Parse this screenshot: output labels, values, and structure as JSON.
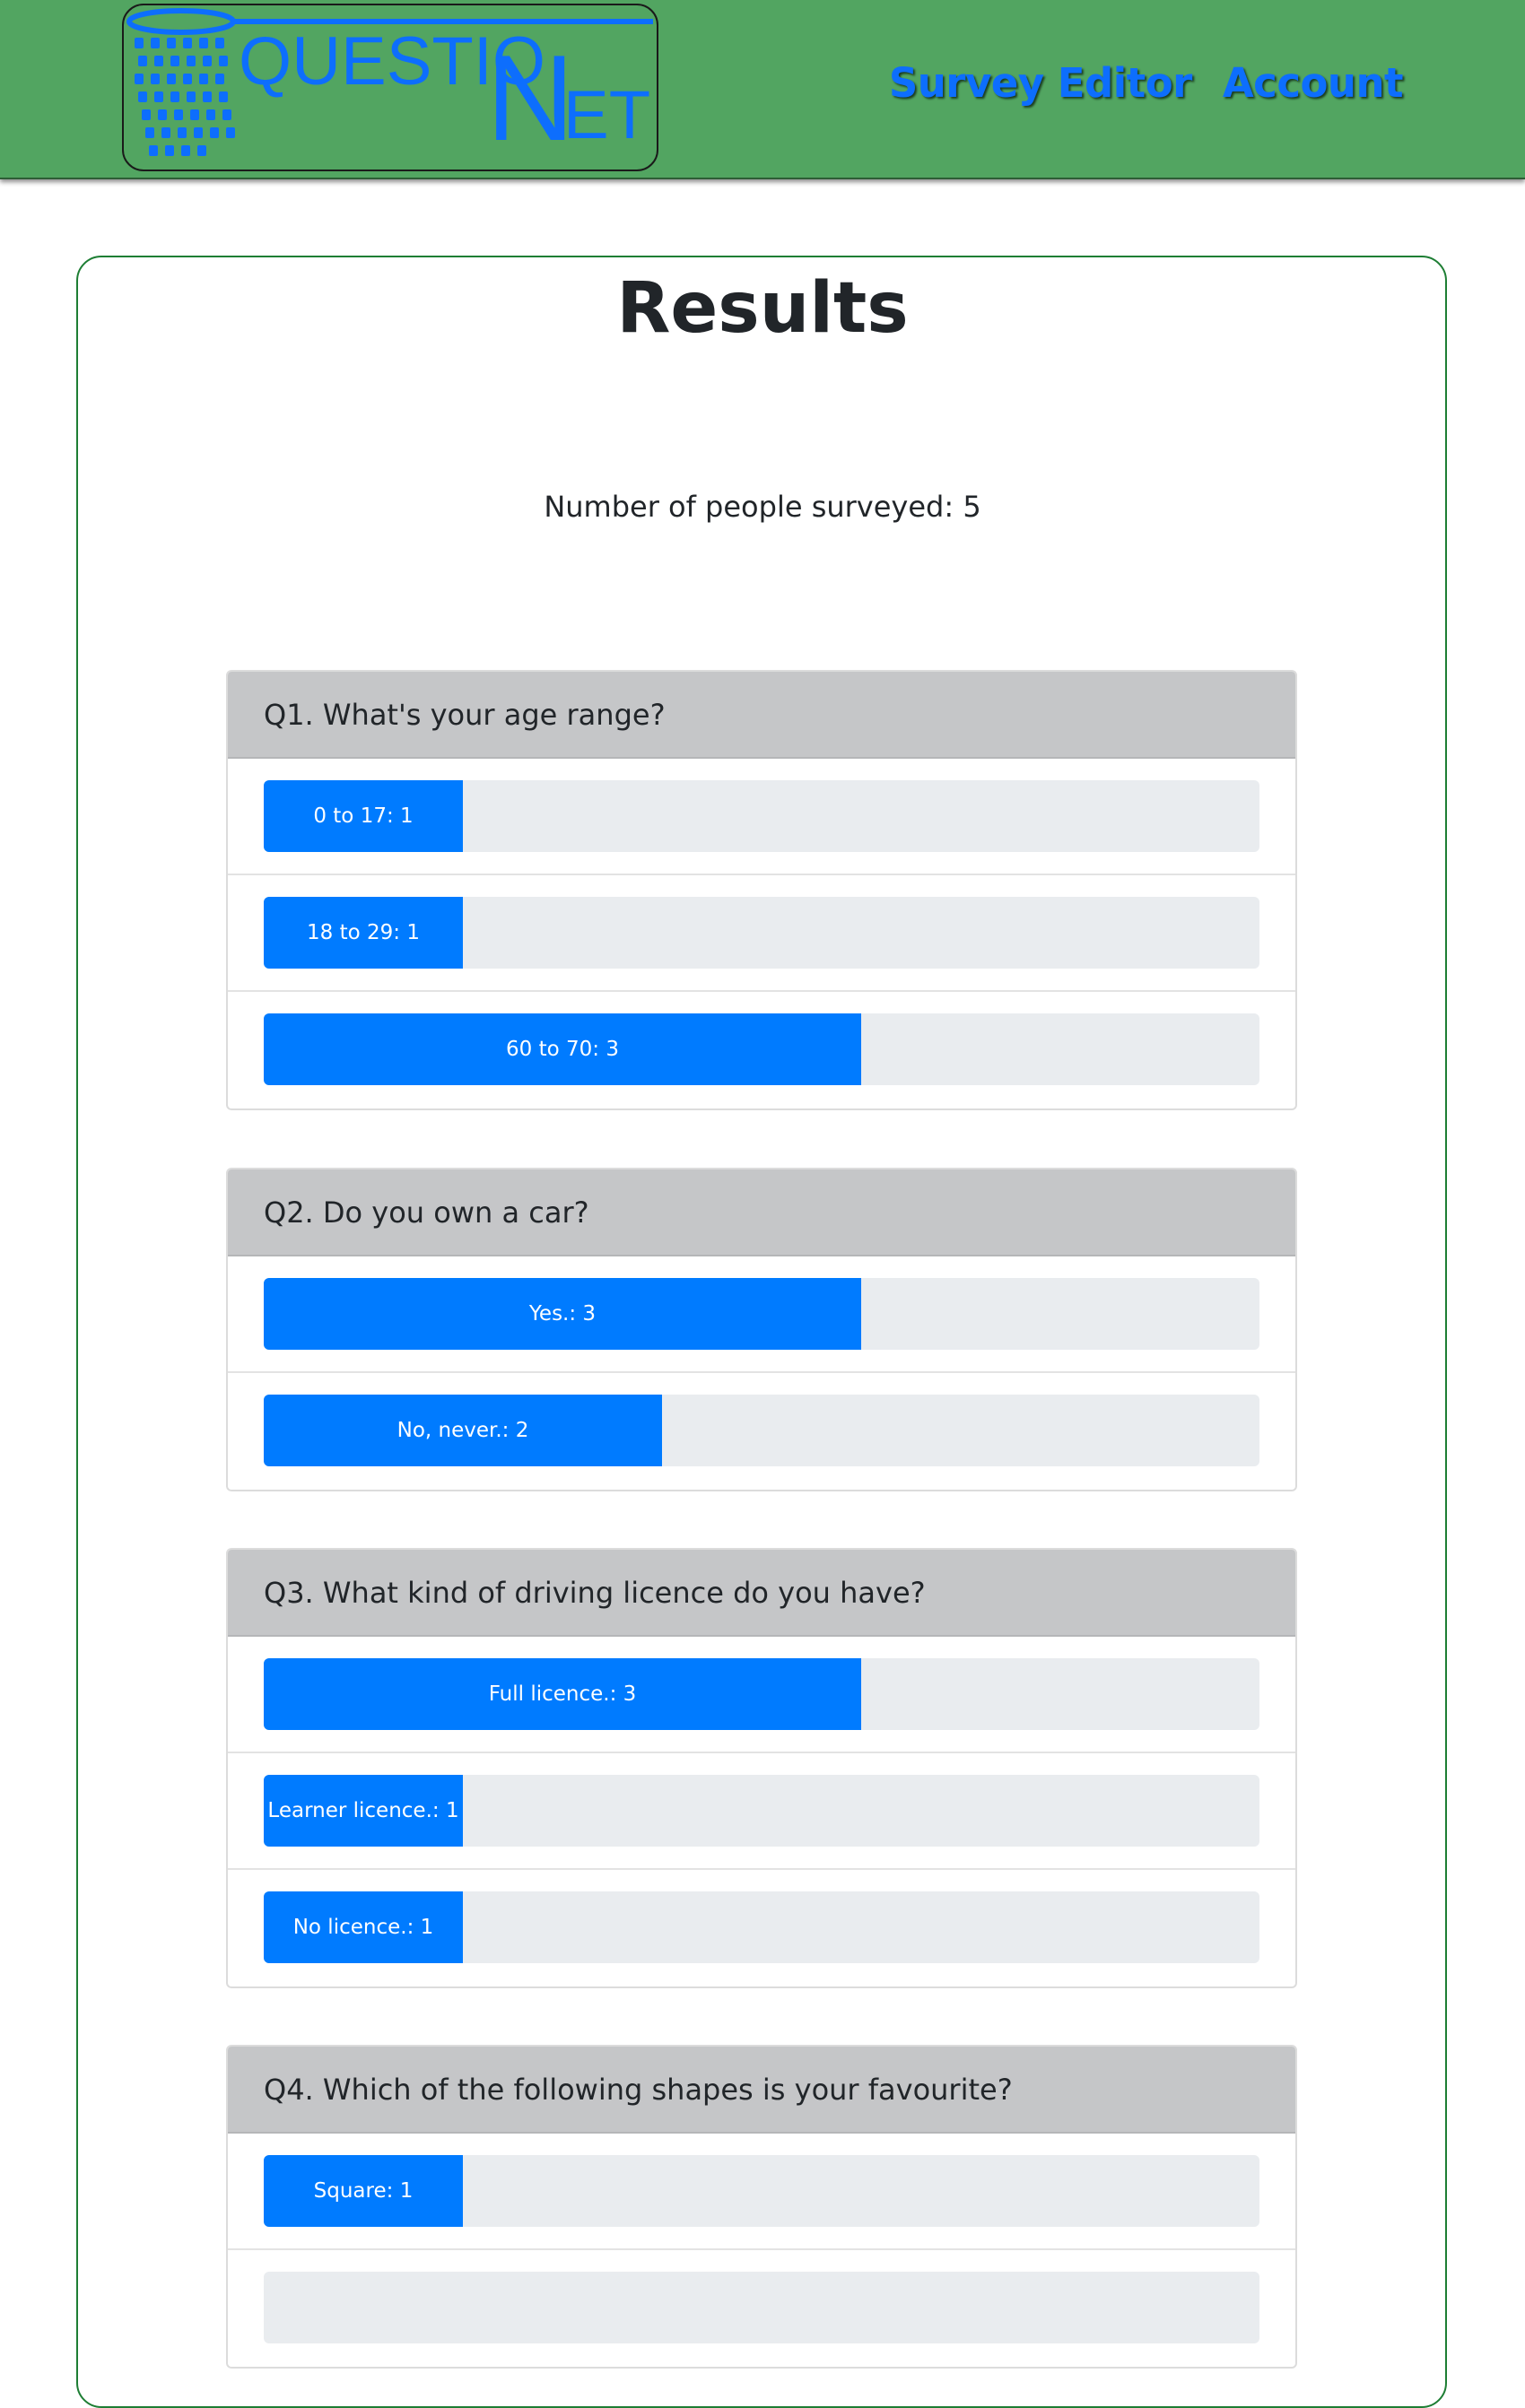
{
  "header": {
    "logo": {
      "text_left": "QUESTIO",
      "text_big": "N",
      "text_right": "ET",
      "alt": "QuestionNet"
    },
    "nav": [
      {
        "label": "Survey Editor"
      },
      {
        "label": "Account"
      }
    ],
    "colors": {
      "bar": "#52a561",
      "link": "#0d6efd"
    }
  },
  "results": {
    "title": "Results",
    "surveyed_text": "Number of people surveyed: 5",
    "total": 5
  },
  "questions": [
    {
      "title": "Q1. What's your age range?",
      "answers": [
        {
          "label": "0 to 17: 1",
          "count": 1
        },
        {
          "label": "18 to 29: 1",
          "count": 1
        },
        {
          "label": "60 to 70: 3",
          "count": 3
        }
      ]
    },
    {
      "title": "Q2. Do you own a car?",
      "answers": [
        {
          "label": "Yes.: 3",
          "count": 3
        },
        {
          "label": "No, never.: 2",
          "count": 2
        }
      ]
    },
    {
      "title": "Q3. What kind of driving licence do you have?",
      "answers": [
        {
          "label": "Full licence.: 3",
          "count": 3
        },
        {
          "label": "Learner licence.: 1",
          "count": 1
        },
        {
          "label": "No licence.: 1",
          "count": 1
        }
      ]
    },
    {
      "title": "Q4. Which of the following shapes is your favourite?",
      "answers": [
        {
          "label": "Square: 1",
          "count": 1
        }
      ]
    }
  ],
  "colors": {
    "progress_fill": "#007bff",
    "progress_track": "#e9ecef",
    "card_border": "#1e7e34"
  }
}
